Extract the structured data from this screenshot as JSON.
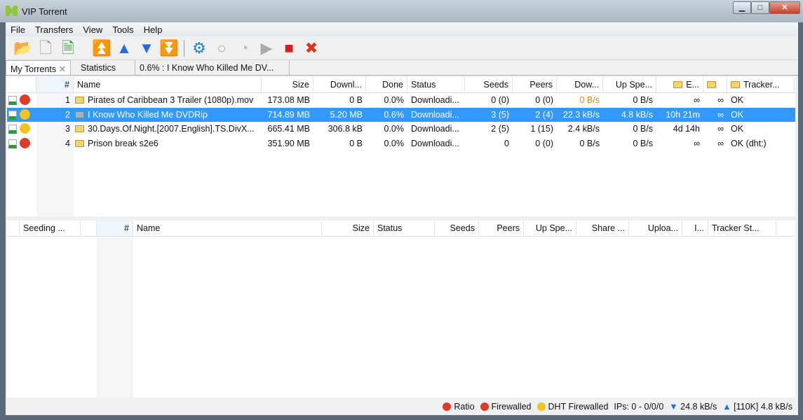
{
  "window": {
    "title": "VIP Torrent",
    "min": "▁",
    "max": "□",
    "close": "✕"
  },
  "menu": [
    "File",
    "Transfers",
    "View",
    "Tools",
    "Help"
  ],
  "toolbar": [
    {
      "name": "open-torrent-icon",
      "glyph": "📂",
      "color": "#2a6fd0"
    },
    {
      "name": "new-torrent-icon",
      "glyph": "🗋",
      "color": "#999"
    },
    {
      "name": "open-url-icon",
      "glyph": "🗎",
      "color": "#2a9d3a"
    },
    {
      "name": "move-top-icon",
      "glyph": "⏫",
      "color": "#1f6fe0"
    },
    {
      "name": "move-up-icon",
      "glyph": "▲",
      "color": "#1f6fe0"
    },
    {
      "name": "move-down-icon",
      "glyph": "▼",
      "color": "#1f6fe0"
    },
    {
      "name": "move-bottom-icon",
      "glyph": "⏬",
      "color": "#1f6fe0"
    },
    {
      "name": "settings-icon",
      "glyph": "⚙",
      "color": "#1f7fd8"
    },
    {
      "name": "queue-icon",
      "glyph": "○",
      "color": "#aaa"
    },
    {
      "name": "force-start-icon",
      "glyph": "◔",
      "color": "#bbb"
    },
    {
      "name": "start-icon",
      "glyph": "▶",
      "color": "#aaa"
    },
    {
      "name": "stop-icon",
      "glyph": "■",
      "color": "#d42020"
    },
    {
      "name": "remove-icon",
      "glyph": "✖",
      "color": "#e03020"
    }
  ],
  "tabs": [
    "My Torrents",
    "Statistics",
    "0.6% : I Know Who Killed Me DV..."
  ],
  "top": {
    "columns": [
      "",
      "#",
      "Name",
      "Size",
      "Downl...",
      "Done",
      "Status",
      "Seeds",
      "Peers",
      "Dow...",
      "Up Spe...",
      "E...",
      "",
      "Tracker..."
    ],
    "rows": [
      {
        "num": "1",
        "state": "red",
        "name": "Pirates of Caribbean 3 Trailer (1080p).mov",
        "size": "173.08 MB",
        "down": "0 B",
        "done": "0.0%",
        "status": "Downloadi...",
        "seeds": "0 (0)",
        "peers": "0 (0)",
        "dspeed": "0 B/s",
        "uspeed": "0 B/s",
        "eta": "∞",
        "c2": "∞",
        "tracker": "OK"
      },
      {
        "num": "2",
        "state": "yellow",
        "name": "I Know Who Killed Me DVDRip",
        "size": "714.89 MB",
        "down": "5.20 MB",
        "done": "0.6%",
        "status": "Downloadi...",
        "seeds": "3 (5)",
        "peers": "2 (4)",
        "dspeed": "22.3 kB/s",
        "uspeed": "4.8 kB/s",
        "eta": "10h 21m",
        "c2": "∞",
        "tracker": "OK",
        "selected": true
      },
      {
        "num": "3",
        "state": "yellow",
        "name": "30.Days.Of.Night.[2007.English].TS.DivX...",
        "size": "665.41 MB",
        "down": "306.8 kB",
        "done": "0.0%",
        "status": "Downloadi...",
        "seeds": "2 (5)",
        "peers": "1 (15)",
        "dspeed": "2.4 kB/s",
        "uspeed": "0 B/s",
        "eta": "4d 14h",
        "c2": "∞",
        "tracker": "OK"
      },
      {
        "num": "4",
        "state": "red",
        "name": "Prison break s2e6",
        "size": "351.90 MB",
        "down": "0 B",
        "done": "0.0%",
        "status": "Downloadi...",
        "seeds": "0",
        "peers": "0 (0)",
        "dspeed": "0 B/s",
        "uspeed": "0 B/s",
        "eta": "∞",
        "c2": "∞",
        "tracker": "OK (dht:)"
      }
    ]
  },
  "bottom": {
    "columns": [
      "",
      "Seeding ...",
      "",
      "#",
      "Name",
      "Size",
      "Status",
      "Seeds",
      "Peers",
      "Up Spe...",
      "Share ...",
      "Uploa...",
      "I...",
      "Tracker St..."
    ]
  },
  "statusbar": {
    "ratio": "Ratio",
    "firewalled": "Firewalled",
    "dht": "DHT Firewalled",
    "ips": "IPs: 0 - 0/0/0",
    "down": "24.8 kB/s",
    "up": "[110K] 4.8 kB/s"
  },
  "colors": {
    "selection": "#3399ff",
    "red": "#e03a2a",
    "yellow": "#f2c320",
    "orange_speed": "#e08a20"
  }
}
